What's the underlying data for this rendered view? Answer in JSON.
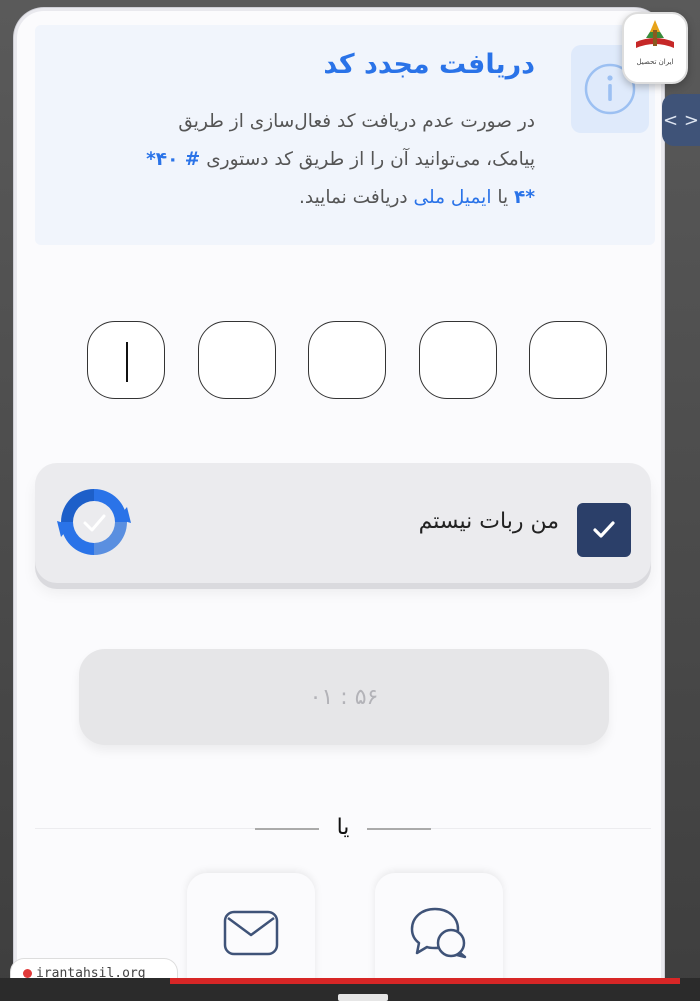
{
  "info": {
    "title": "دریافت مجدد کد",
    "desc_line1": "در صورت عدم دریافت کد فعال‌سازی از طریق",
    "desc_line2_text": "پیامک، می‌توانید آن را از طریق کد دستوری",
    "ussd_code": "*۴۰ #",
    "desc_line3_star": "*۴",
    "desc_line3_text": " یا ",
    "national_email": "ایمیل ملی",
    "desc_line3_end": " دریافت نمایید."
  },
  "otp": {
    "length": 5,
    "digits": [
      "",
      "",
      "",
      "",
      ""
    ]
  },
  "captcha": {
    "label": "من ربات نیستم",
    "checked": true
  },
  "timer": {
    "text": "۰۱ : ۵۶"
  },
  "divider": {
    "or_text": "یا"
  },
  "side_tab": {
    "icon_text": "< >"
  },
  "watermark": {
    "text": "irantahsil.org"
  },
  "logo": {
    "text": "ایران تحصیل"
  },
  "colors": {
    "accent": "#2a73e8",
    "navy": "#2b3f69",
    "captcha_blue": "#2a73e8"
  }
}
